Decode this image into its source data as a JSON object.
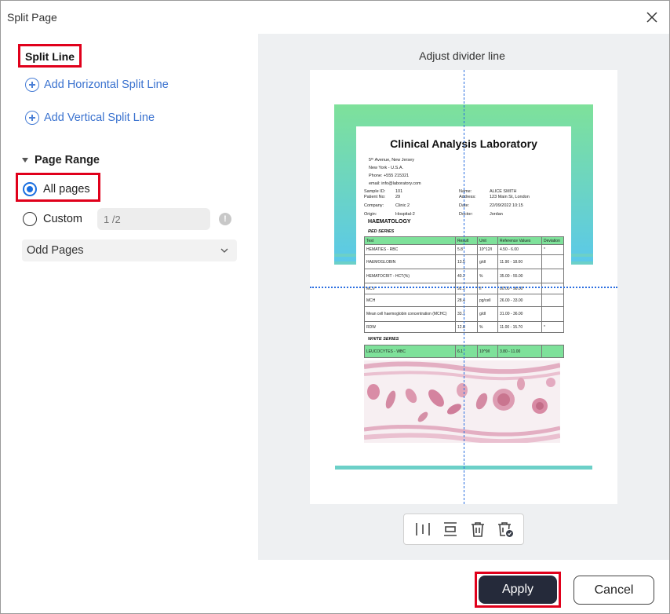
{
  "window": {
    "title": "Split Page",
    "close_icon": "close-icon"
  },
  "split_line": {
    "heading": "Split Line",
    "add_horizontal": "Add Horizontal Split Line",
    "add_vertical": "Add Vertical Split Line"
  },
  "page_range": {
    "heading": "Page Range",
    "all_pages": "All pages",
    "custom": "Custom",
    "custom_placeholder": "1 /2",
    "info_glyph": "!",
    "subset_selected": "Odd Pages",
    "selected_option": "all_pages"
  },
  "preview": {
    "label": "Adjust divider line",
    "doc": {
      "title": "Clinical Analysis Laboratory",
      "address_lines": [
        "5ᵗʰ Avenue, New Jersey",
        "New York - U.S.A.",
        "Phone: +555 215321",
        "email: info@laboratory.com"
      ],
      "left_fields": [
        [
          "Sample ID:",
          "101"
        ],
        [
          "Patient No:",
          "29"
        ],
        [
          "Company:",
          "Clinic 2"
        ],
        [
          "Origin:",
          "Hospital-2"
        ]
      ],
      "right_fields": [
        [
          "Name:",
          "ALICE SMITH"
        ],
        [
          "Address:",
          "123 Main St, London"
        ],
        [
          "Date:",
          "22/09/2022 10:15"
        ],
        [
          "Doctor:",
          "Jordan"
        ]
      ],
      "section": "HAEMATOLOGY",
      "red_series": "RED SERIES",
      "white_series": "WHITE SERIES",
      "columns": [
        "Test",
        "Result",
        "Unit",
        "Reference Values",
        "Deviation"
      ],
      "rows": [
        [
          "HEMATIES - RBC",
          "5.8",
          "10^12/l",
          "4.50 - 6.00",
          "*"
        ],
        [
          "HAEMOGLOBIN",
          "13.5",
          "g/dl",
          "11.90 - 18.00",
          ""
        ],
        [
          "HEMATOCRIT - HCT(%)",
          "40.2",
          "%",
          "35.00 - 55.00",
          ""
        ],
        [
          "MCV",
          "92.5",
          "fl",
          "80.00 - 98.00",
          ""
        ],
        [
          "MCH",
          "28.4",
          "pg/cell",
          "26.00 - 33.00",
          ""
        ],
        [
          "Mean cell haemoglobin concentration (MCHC)",
          "33.1",
          "g/dl",
          "31.00 - 36.00",
          ""
        ],
        [
          "RDW",
          "12.8",
          "%",
          "11.00 - 15.70",
          "*"
        ]
      ],
      "white_row": [
        "LEUCOCYTES - WBC",
        "6.1",
        "10^9/l",
        "3.80 - 11.00",
        ""
      ]
    }
  },
  "toolbar": {
    "tools": [
      "vertical-split-icon",
      "horizontal-split-icon",
      "delete-icon",
      "delete-all-icon"
    ]
  },
  "footer": {
    "apply": "Apply",
    "cancel": "Cancel"
  },
  "colors": {
    "accent": "#1a6fe0",
    "link": "#3a72cf",
    "highlight": "#e0001b",
    "apply_bg": "#252a3a",
    "header_green": "#7ee19a"
  }
}
